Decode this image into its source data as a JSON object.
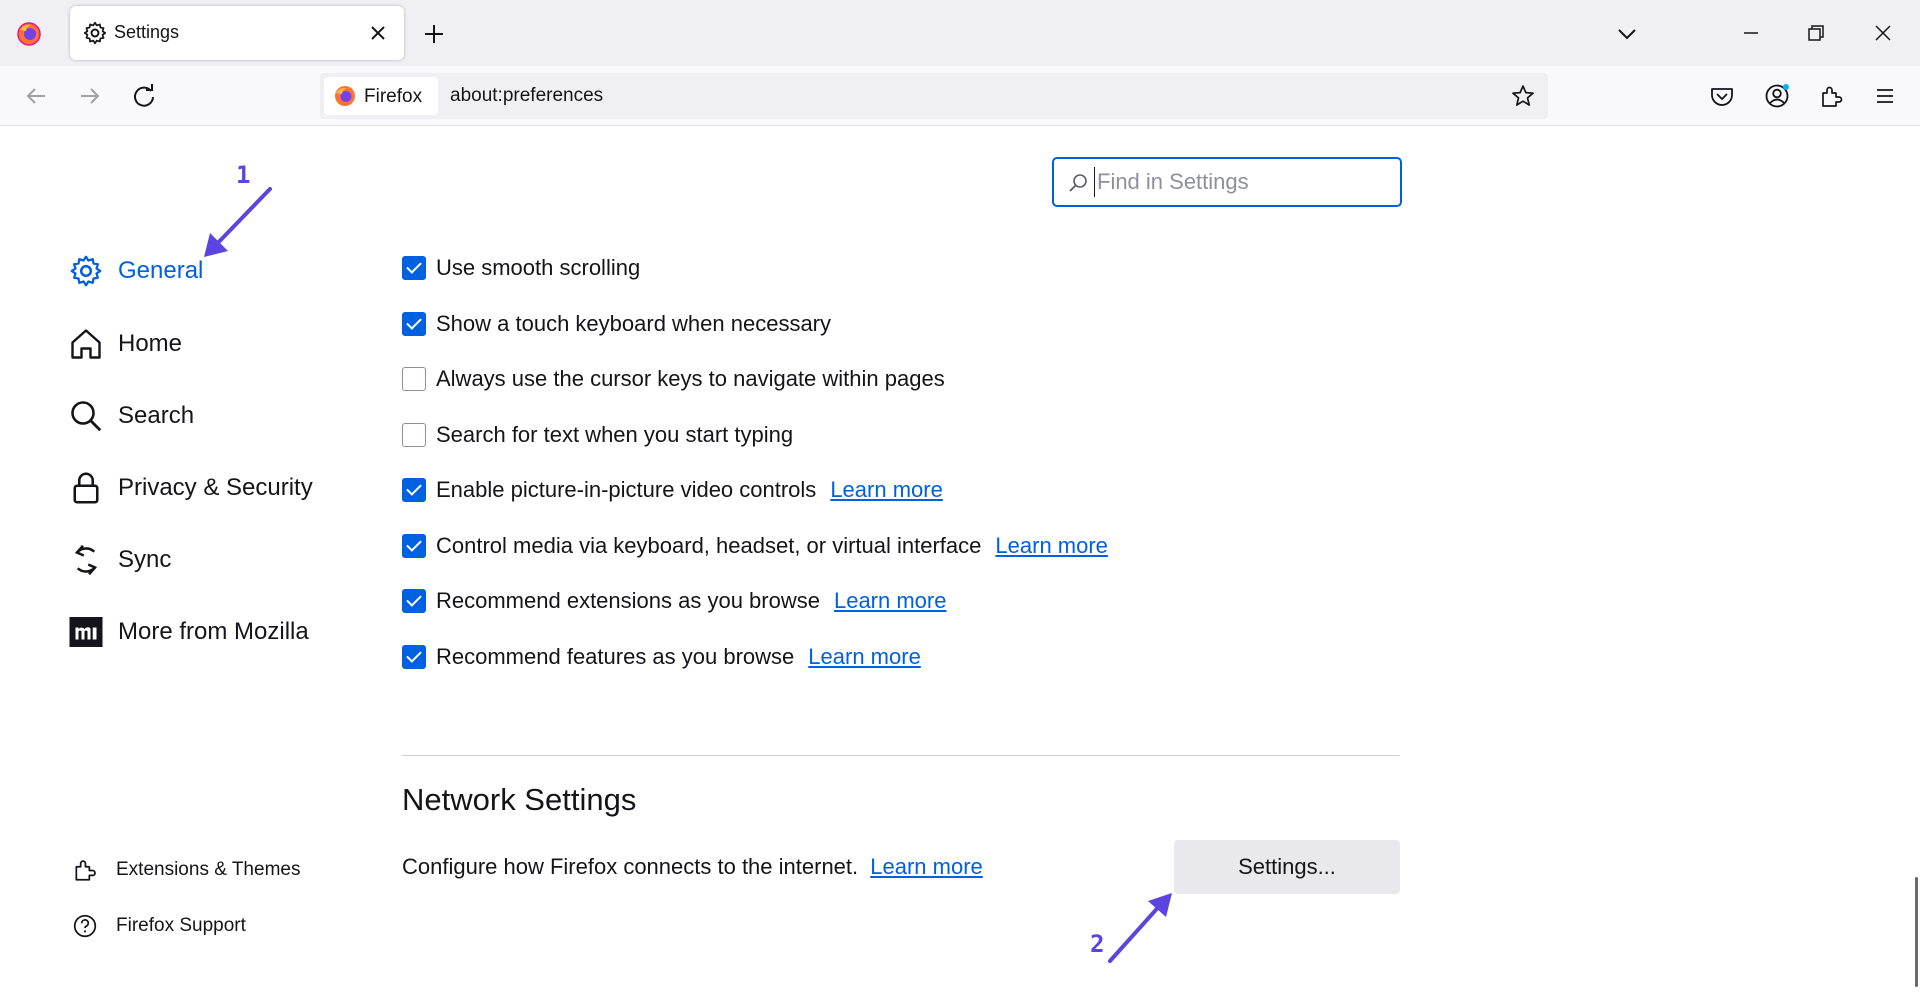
{
  "browser": {
    "tab": {
      "title": "Settings",
      "icon": "gear-icon"
    },
    "identity_label": "Firefox",
    "url": "about:preferences"
  },
  "search": {
    "placeholder": "Find in Settings",
    "value": ""
  },
  "sidebar": {
    "categories": [
      {
        "label": "General",
        "icon": "gear-icon",
        "selected": true
      },
      {
        "label": "Home",
        "icon": "home-icon",
        "selected": false
      },
      {
        "label": "Search",
        "icon": "search-icon",
        "selected": false
      },
      {
        "label": "Privacy & Security",
        "icon": "lock-icon",
        "selected": false
      },
      {
        "label": "Sync",
        "icon": "sync-icon",
        "selected": false
      },
      {
        "label": "More from Mozilla",
        "icon": "mozilla-icon",
        "selected": false
      }
    ],
    "footer": [
      {
        "label": "Extensions & Themes",
        "icon": "puzzle-icon"
      },
      {
        "label": "Firefox Support",
        "icon": "help-icon"
      }
    ]
  },
  "browsing_options": [
    {
      "label": "Use smooth scrolling",
      "checked": true,
      "learn_more": ""
    },
    {
      "label": "Show a touch keyboard when necessary",
      "checked": true,
      "learn_more": ""
    },
    {
      "label": "Always use the cursor keys to navigate within pages",
      "checked": false,
      "learn_more": ""
    },
    {
      "label": "Search for text when you start typing",
      "checked": false,
      "learn_more": ""
    },
    {
      "label": "Enable picture-in-picture video controls",
      "checked": true,
      "learn_more": "Learn more"
    },
    {
      "label": "Control media via keyboard, headset, or virtual interface",
      "checked": true,
      "learn_more": "Learn more"
    },
    {
      "label": "Recommend extensions as you browse",
      "checked": true,
      "learn_more": "Learn more"
    },
    {
      "label": "Recommend features as you browse",
      "checked": true,
      "learn_more": "Learn more"
    }
  ],
  "network": {
    "title": "Network Settings",
    "description": "Configure how Firefox connects to the internet.",
    "learn_more": "Learn more",
    "button": "Settings..."
  },
  "annotations": {
    "step1": "1",
    "step2": "2",
    "color": "#5b45e0"
  },
  "colors": {
    "accent": "#0061e0",
    "text": "#15141a"
  }
}
